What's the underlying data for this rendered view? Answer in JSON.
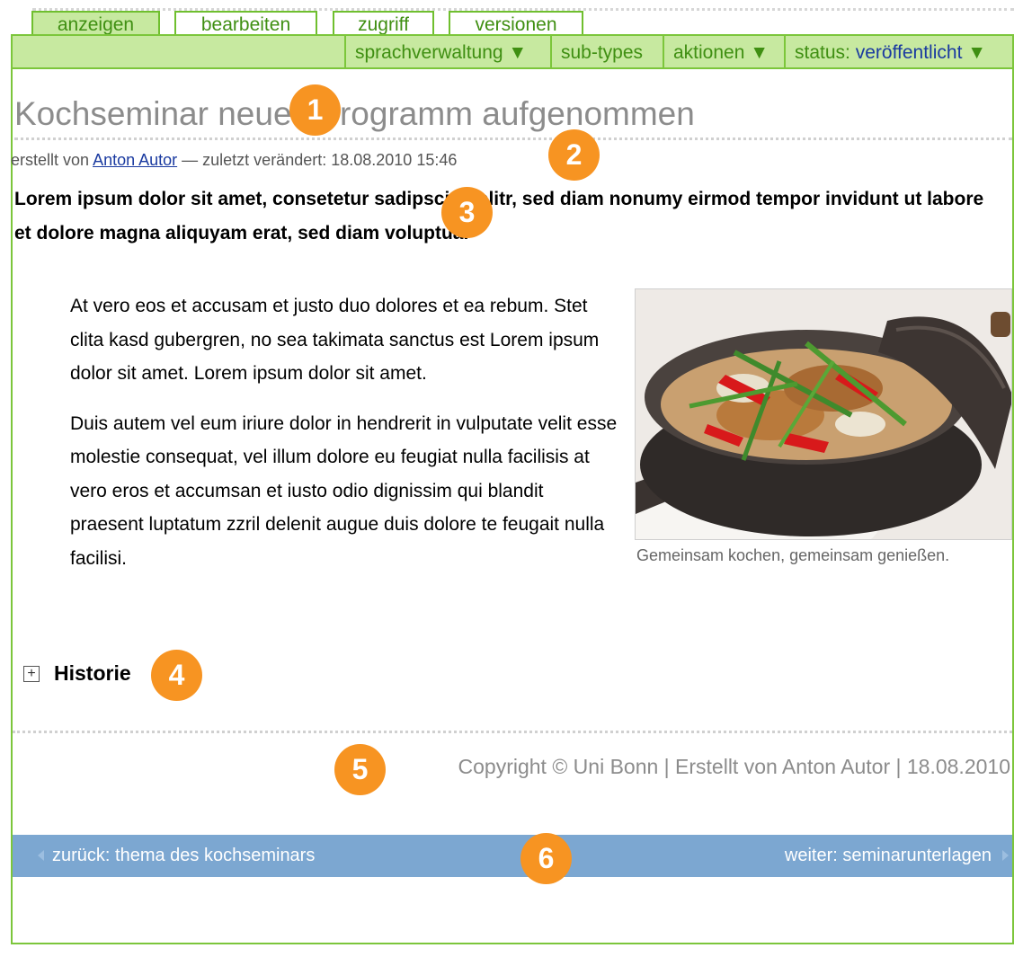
{
  "tabs": [
    {
      "label": "anzeigen",
      "active": true
    },
    {
      "label": "bearbeiten",
      "active": false
    },
    {
      "label": "zugriff",
      "active": false
    },
    {
      "label": "versionen",
      "active": false
    }
  ],
  "actions": {
    "sprachverwaltung": "sprachverwaltung ▼",
    "subtypes": "sub-types",
    "aktionen": "aktionen ▼",
    "status_label": "status:",
    "status_value": "veröffentlicht",
    "status_arrow": "▼"
  },
  "article": {
    "title": "Kochseminar neues Programm aufgenommen",
    "byline_prefix": "erstellt von",
    "author": "Anton Autor",
    "byline_suffix": "— zuletzt verändert: 18.08.2010 15:46",
    "lead": "Lorem ipsum dolor sit amet, consetetur sadipscing elitr, sed diam nonumy eirmod tempor invidunt ut labore et dolore magna aliquyam erat, sed diam voluptua.",
    "paragraphs": [
      "At vero eos et accusam et justo duo dolores et ea rebum. Stet clita kasd gubergren, no sea takimata sanctus est Lorem ipsum dolor sit amet. Lorem ipsum dolor sit amet.",
      "Duis autem vel eum iriure dolor in hendrerit in vulputate velit esse molestie consequat, vel illum dolore eu feugiat nulla facilisis at vero eros et accumsan et iusto odio dignissim qui blandit praesent luptatum zzril delenit augue duis dolore te feugait nulla facilisi."
    ],
    "image_caption": "Gemeinsam kochen, gemeinsam genießen."
  },
  "history": {
    "icon": "+",
    "label": "Historie"
  },
  "footer": {
    "copyright": "Copyright © Uni Bonn | Erstellt von Anton Autor | 18.08.2010"
  },
  "nav": {
    "prev": "zurück: thema des kochseminars",
    "next": "weiter: seminarunterlagen"
  },
  "badges": [
    "1",
    "2",
    "3",
    "4",
    "5",
    "6"
  ],
  "colors": {
    "green": "#7cc63b",
    "green_light": "#c7e9a0",
    "nav_blue": "#7ca7d1",
    "badge_orange": "#f79422",
    "link_blue": "#1a3aa0"
  }
}
